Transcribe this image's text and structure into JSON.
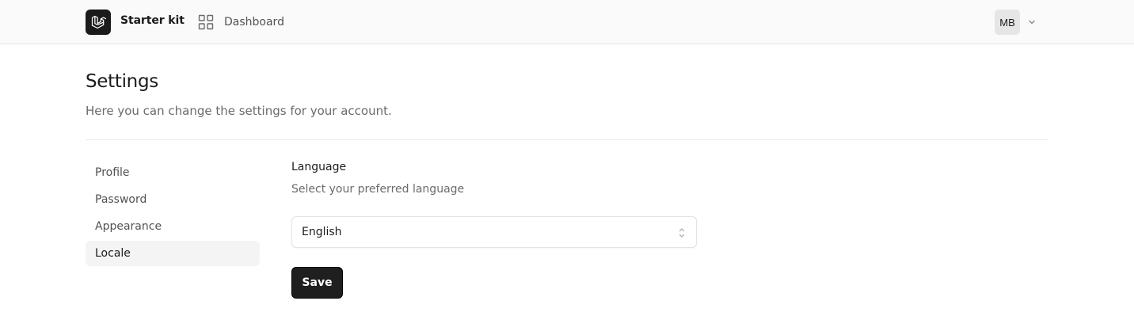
{
  "header": {
    "app_name": "Starter kit",
    "logo_icon": "laravel-logo-icon",
    "nav": [
      {
        "label": "Dashboard",
        "icon": "grid-icon"
      }
    ],
    "user_initials": "MB",
    "user_menu_icon": "chevron-down-icon"
  },
  "page": {
    "title": "Settings",
    "subtitle": "Here you can change the settings for your account."
  },
  "sidebar": {
    "items": [
      {
        "label": "Profile",
        "active": false
      },
      {
        "label": "Password",
        "active": false
      },
      {
        "label": "Appearance",
        "active": false
      },
      {
        "label": "Locale",
        "active": true
      }
    ]
  },
  "locale": {
    "title": "Language",
    "description": "Select your preferred language",
    "selected_language": "English",
    "save_label": "Save"
  },
  "colors": {
    "primary": "#1f1f1f",
    "header_bg": "#fafafa",
    "active_nav_bg": "#f4f4f4",
    "muted_text": "#6b6b6b"
  }
}
